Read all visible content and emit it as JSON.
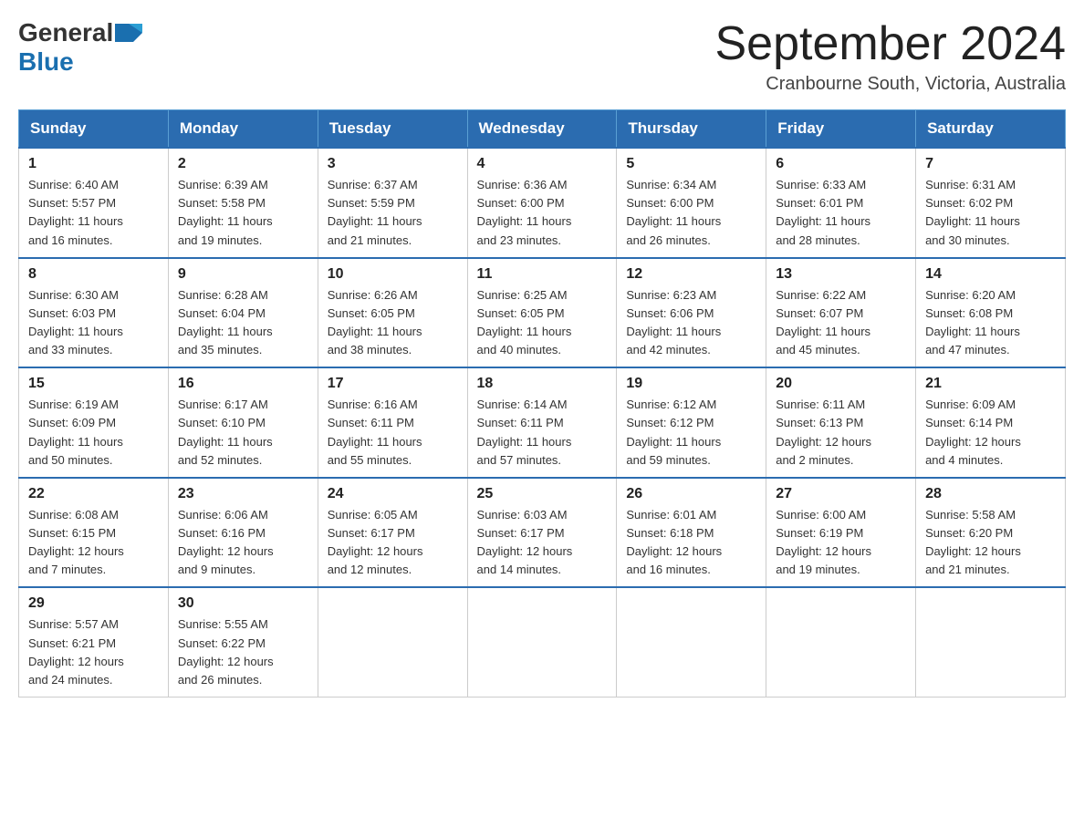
{
  "header": {
    "logo_general": "General",
    "logo_blue": "Blue",
    "month_title": "September 2024",
    "location": "Cranbourne South, Victoria, Australia"
  },
  "days_of_week": [
    "Sunday",
    "Monday",
    "Tuesday",
    "Wednesday",
    "Thursday",
    "Friday",
    "Saturday"
  ],
  "weeks": [
    [
      {
        "day": "1",
        "sunrise": "6:40 AM",
        "sunset": "5:57 PM",
        "daylight": "11 hours and 16 minutes."
      },
      {
        "day": "2",
        "sunrise": "6:39 AM",
        "sunset": "5:58 PM",
        "daylight": "11 hours and 19 minutes."
      },
      {
        "day": "3",
        "sunrise": "6:37 AM",
        "sunset": "5:59 PM",
        "daylight": "11 hours and 21 minutes."
      },
      {
        "day": "4",
        "sunrise": "6:36 AM",
        "sunset": "6:00 PM",
        "daylight": "11 hours and 23 minutes."
      },
      {
        "day": "5",
        "sunrise": "6:34 AM",
        "sunset": "6:00 PM",
        "daylight": "11 hours and 26 minutes."
      },
      {
        "day": "6",
        "sunrise": "6:33 AM",
        "sunset": "6:01 PM",
        "daylight": "11 hours and 28 minutes."
      },
      {
        "day": "7",
        "sunrise": "6:31 AM",
        "sunset": "6:02 PM",
        "daylight": "11 hours and 30 minutes."
      }
    ],
    [
      {
        "day": "8",
        "sunrise": "6:30 AM",
        "sunset": "6:03 PM",
        "daylight": "11 hours and 33 minutes."
      },
      {
        "day": "9",
        "sunrise": "6:28 AM",
        "sunset": "6:04 PM",
        "daylight": "11 hours and 35 minutes."
      },
      {
        "day": "10",
        "sunrise": "6:26 AM",
        "sunset": "6:05 PM",
        "daylight": "11 hours and 38 minutes."
      },
      {
        "day": "11",
        "sunrise": "6:25 AM",
        "sunset": "6:05 PM",
        "daylight": "11 hours and 40 minutes."
      },
      {
        "day": "12",
        "sunrise": "6:23 AM",
        "sunset": "6:06 PM",
        "daylight": "11 hours and 42 minutes."
      },
      {
        "day": "13",
        "sunrise": "6:22 AM",
        "sunset": "6:07 PM",
        "daylight": "11 hours and 45 minutes."
      },
      {
        "day": "14",
        "sunrise": "6:20 AM",
        "sunset": "6:08 PM",
        "daylight": "11 hours and 47 minutes."
      }
    ],
    [
      {
        "day": "15",
        "sunrise": "6:19 AM",
        "sunset": "6:09 PM",
        "daylight": "11 hours and 50 minutes."
      },
      {
        "day": "16",
        "sunrise": "6:17 AM",
        "sunset": "6:10 PM",
        "daylight": "11 hours and 52 minutes."
      },
      {
        "day": "17",
        "sunrise": "6:16 AM",
        "sunset": "6:11 PM",
        "daylight": "11 hours and 55 minutes."
      },
      {
        "day": "18",
        "sunrise": "6:14 AM",
        "sunset": "6:11 PM",
        "daylight": "11 hours and 57 minutes."
      },
      {
        "day": "19",
        "sunrise": "6:12 AM",
        "sunset": "6:12 PM",
        "daylight": "11 hours and 59 minutes."
      },
      {
        "day": "20",
        "sunrise": "6:11 AM",
        "sunset": "6:13 PM",
        "daylight": "12 hours and 2 minutes."
      },
      {
        "day": "21",
        "sunrise": "6:09 AM",
        "sunset": "6:14 PM",
        "daylight": "12 hours and 4 minutes."
      }
    ],
    [
      {
        "day": "22",
        "sunrise": "6:08 AM",
        "sunset": "6:15 PM",
        "daylight": "12 hours and 7 minutes."
      },
      {
        "day": "23",
        "sunrise": "6:06 AM",
        "sunset": "6:16 PM",
        "daylight": "12 hours and 9 minutes."
      },
      {
        "day": "24",
        "sunrise": "6:05 AM",
        "sunset": "6:17 PM",
        "daylight": "12 hours and 12 minutes."
      },
      {
        "day": "25",
        "sunrise": "6:03 AM",
        "sunset": "6:17 PM",
        "daylight": "12 hours and 14 minutes."
      },
      {
        "day": "26",
        "sunrise": "6:01 AM",
        "sunset": "6:18 PM",
        "daylight": "12 hours and 16 minutes."
      },
      {
        "day": "27",
        "sunrise": "6:00 AM",
        "sunset": "6:19 PM",
        "daylight": "12 hours and 19 minutes."
      },
      {
        "day": "28",
        "sunrise": "5:58 AM",
        "sunset": "6:20 PM",
        "daylight": "12 hours and 21 minutes."
      }
    ],
    [
      {
        "day": "29",
        "sunrise": "5:57 AM",
        "sunset": "6:21 PM",
        "daylight": "12 hours and 24 minutes."
      },
      {
        "day": "30",
        "sunrise": "5:55 AM",
        "sunset": "6:22 PM",
        "daylight": "12 hours and 26 minutes."
      },
      null,
      null,
      null,
      null,
      null
    ]
  ],
  "labels": {
    "sunrise_prefix": "Sunrise: ",
    "sunset_prefix": "Sunset: ",
    "daylight_prefix": "Daylight: "
  }
}
